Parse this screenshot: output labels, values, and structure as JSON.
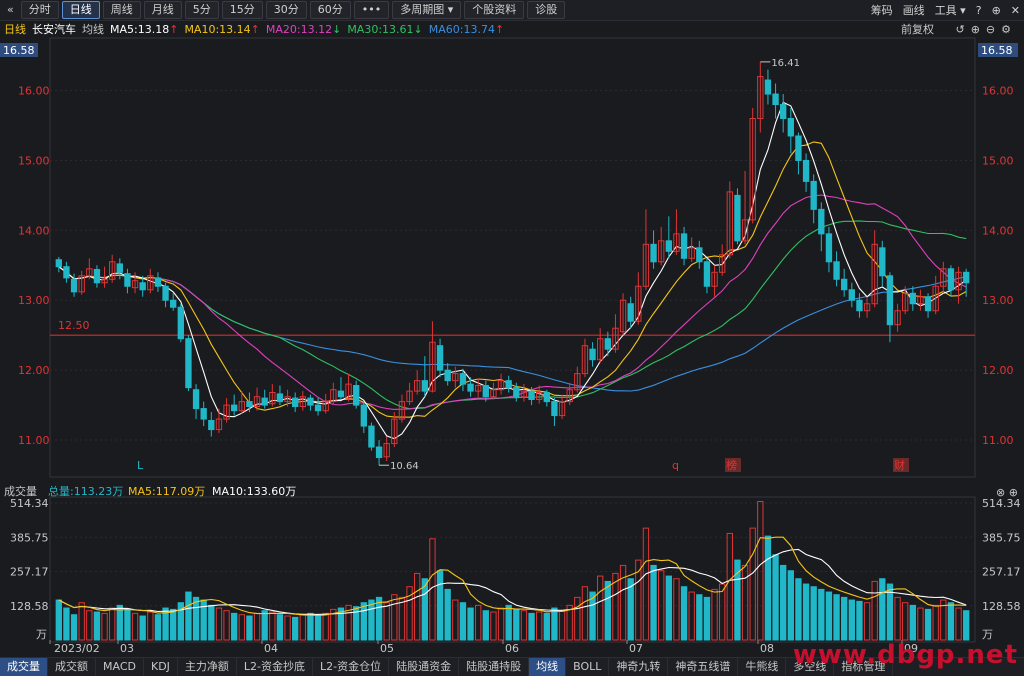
{
  "toolbar": {
    "back_icon": "chevron-double-left-icon",
    "periods": [
      "分时",
      "日线",
      "周线",
      "月线",
      "5分",
      "15分",
      "30分",
      "60分",
      "•••",
      "多周期图",
      "个股资料",
      "诊股"
    ],
    "active": "日线",
    "right": [
      "筹码",
      "画线",
      "工具"
    ],
    "icons": [
      "question-icon",
      "plus-circle-icon",
      "close-icon"
    ]
  },
  "info": {
    "period": "日线",
    "name": "长安汽车",
    "avg": "均线",
    "ma5": "MA5:13.18",
    "ma10": "MA10:13.14",
    "ma20": "MA20:13.12",
    "ma30": "MA30:13.61",
    "ma60": "MA60:13.74",
    "adjust": "前复权",
    "colors": {
      "ma5": "#ffffff",
      "ma10": "#f5c518",
      "ma20": "#e040c0",
      "ma30": "#30c060",
      "ma60": "#3a8fe0",
      "up": "#e03434",
      "down": "#20b8c8"
    }
  },
  "price_axis": {
    "top_label": "16.58",
    "ticks": [
      "16.00",
      "15.00",
      "14.00",
      "13.00",
      "12.00",
      "11.00"
    ],
    "high_label": "16.41",
    "low_label": "10.64",
    "line_label": "12.50",
    "markers": [
      "L",
      "q",
      "榜",
      "财"
    ]
  },
  "volume": {
    "title": "成交量",
    "total": "总量:113.23万",
    "ma5": "MA5:117.09万",
    "ma10": "MA10:133.60万",
    "ticks": [
      "514.34",
      "385.75",
      "257.17",
      "128.58",
      "万"
    ]
  },
  "x_axis": [
    "2023/02",
    "03",
    "04",
    "05",
    "06",
    "07",
    "08",
    "09"
  ],
  "bottom_tabs": [
    "成交量",
    "成交额",
    "MACD",
    "KDJ",
    "主力净额",
    "L2-资金抄底",
    "L2-资金仓位",
    "陆股通资金",
    "陆股通持股",
    "均线",
    "BOLL",
    "神奇九转",
    "神奇五线谱",
    "牛熊线",
    "多空线",
    "指标管理"
  ],
  "watermark": "www.dbgp.net",
  "chart_data": {
    "type": "candlestick",
    "price_range": [
      10.5,
      16.58
    ],
    "volume_range": [
      0,
      514.34
    ],
    "candles": [
      [
        13.58,
        13.48,
        13.62,
        13.4
      ],
      [
        13.48,
        13.32,
        13.55,
        13.25
      ],
      [
        13.3,
        13.12,
        13.38,
        13.05
      ],
      [
        13.12,
        13.35,
        13.42,
        13.08
      ],
      [
        13.35,
        13.45,
        13.6,
        13.3
      ],
      [
        13.44,
        13.25,
        13.5,
        13.18
      ],
      [
        13.25,
        13.3,
        13.48,
        13.18
      ],
      [
        13.3,
        13.55,
        13.65,
        13.25
      ],
      [
        13.52,
        13.4,
        13.6,
        13.3
      ],
      [
        13.38,
        13.2,
        13.45,
        13.1
      ],
      [
        13.18,
        13.28,
        13.4,
        13.1
      ],
      [
        13.25,
        13.15,
        13.35,
        13.05
      ],
      [
        13.15,
        13.35,
        13.45,
        13.1
      ],
      [
        13.32,
        13.2,
        13.4,
        13.12
      ],
      [
        13.2,
        13.0,
        13.25,
        12.9
      ],
      [
        13.0,
        12.9,
        13.1,
        12.85
      ],
      [
        12.9,
        12.45,
        12.95,
        12.4
      ],
      [
        12.45,
        11.75,
        12.5,
        11.7
      ],
      [
        11.72,
        11.45,
        11.8,
        11.3
      ],
      [
        11.45,
        11.3,
        11.55,
        11.2
      ],
      [
        11.28,
        11.15,
        11.4,
        11.05
      ],
      [
        11.15,
        11.3,
        11.45,
        11.1
      ],
      [
        11.3,
        11.5,
        11.6,
        11.25
      ],
      [
        11.5,
        11.42,
        11.65,
        11.35
      ],
      [
        11.42,
        11.55,
        11.7,
        11.38
      ],
      [
        11.55,
        11.48,
        11.68,
        11.4
      ],
      [
        11.48,
        11.62,
        11.75,
        11.42
      ],
      [
        11.6,
        11.5,
        11.72,
        11.45
      ],
      [
        11.52,
        11.68,
        11.8,
        11.48
      ],
      [
        11.66,
        11.55,
        11.78,
        11.5
      ],
      [
        11.55,
        11.62,
        11.72,
        11.48
      ],
      [
        11.6,
        11.48,
        11.68,
        11.4
      ],
      [
        11.48,
        11.62,
        11.7,
        11.42
      ],
      [
        11.6,
        11.5,
        11.65,
        11.42
      ],
      [
        11.5,
        11.42,
        11.6,
        11.35
      ],
      [
        11.42,
        11.56,
        11.66,
        11.38
      ],
      [
        11.55,
        11.72,
        11.82,
        11.5
      ],
      [
        11.7,
        11.62,
        11.9,
        11.58
      ],
      [
        11.6,
        11.8,
        11.95,
        11.55
      ],
      [
        11.78,
        11.5,
        11.85,
        11.45
      ],
      [
        11.5,
        11.2,
        11.55,
        11.1
      ],
      [
        11.2,
        10.9,
        11.25,
        10.85
      ],
      [
        10.9,
        10.75,
        11.0,
        10.64
      ],
      [
        10.76,
        10.95,
        11.05,
        10.7
      ],
      [
        10.95,
        11.3,
        11.4,
        10.9
      ],
      [
        11.3,
        11.55,
        11.65,
        11.25
      ],
      [
        11.55,
        11.7,
        11.82,
        11.5
      ],
      [
        11.7,
        11.85,
        12.0,
        11.65
      ],
      [
        11.85,
        11.7,
        12.2,
        11.62
      ],
      [
        11.7,
        12.4,
        12.7,
        11.68
      ],
      [
        12.35,
        12.0,
        12.45,
        11.9
      ],
      [
        12.0,
        11.85,
        12.1,
        11.78
      ],
      [
        11.85,
        11.95,
        12.05,
        11.75
      ],
      [
        11.95,
        11.8,
        12.02,
        11.7
      ],
      [
        11.8,
        11.7,
        11.9,
        11.62
      ],
      [
        11.7,
        11.78,
        11.88,
        11.62
      ],
      [
        11.78,
        11.62,
        11.85,
        11.55
      ],
      [
        11.62,
        11.72,
        11.82,
        11.58
      ],
      [
        11.72,
        11.85,
        11.95,
        11.65
      ],
      [
        11.85,
        11.75,
        11.92,
        11.68
      ],
      [
        11.75,
        11.62,
        11.82,
        11.55
      ],
      [
        11.62,
        11.7,
        11.8,
        11.55
      ],
      [
        11.7,
        11.58,
        11.76,
        11.5
      ],
      [
        11.58,
        11.68,
        11.78,
        11.52
      ],
      [
        11.68,
        11.55,
        11.72,
        11.48
      ],
      [
        11.55,
        11.35,
        11.6,
        11.2
      ],
      [
        11.35,
        11.55,
        11.65,
        11.3
      ],
      [
        11.55,
        11.72,
        11.82,
        11.5
      ],
      [
        11.72,
        11.95,
        12.05,
        11.68
      ],
      [
        11.95,
        12.35,
        12.45,
        11.9
      ],
      [
        12.3,
        12.15,
        12.4,
        12.05
      ],
      [
        12.15,
        12.45,
        12.6,
        12.1
      ],
      [
        12.45,
        12.3,
        12.55,
        12.2
      ],
      [
        12.3,
        12.6,
        12.8,
        12.25
      ],
      [
        12.55,
        13.0,
        13.1,
        12.5
      ],
      [
        12.95,
        12.7,
        13.05,
        12.6
      ],
      [
        12.7,
        13.2,
        13.4,
        12.65
      ],
      [
        13.2,
        13.8,
        14.3,
        13.15
      ],
      [
        13.8,
        13.55,
        14.0,
        13.45
      ],
      [
        13.55,
        13.85,
        14.05,
        13.5
      ],
      [
        13.85,
        13.7,
        14.2,
        13.6
      ],
      [
        13.7,
        13.95,
        14.3,
        13.65
      ],
      [
        13.95,
        13.6,
        14.05,
        13.5
      ],
      [
        13.6,
        13.75,
        13.9,
        13.55
      ],
      [
        13.75,
        13.55,
        13.85,
        13.45
      ],
      [
        13.55,
        13.2,
        13.6,
        13.1
      ],
      [
        13.2,
        13.4,
        13.5,
        13.05
      ],
      [
        13.4,
        13.65,
        13.8,
        13.35
      ],
      [
        13.65,
        14.55,
        14.7,
        13.6
      ],
      [
        14.5,
        13.85,
        14.6,
        13.8
      ],
      [
        13.85,
        14.15,
        14.85,
        13.8
      ],
      [
        14.15,
        15.6,
        15.75,
        14.1
      ],
      [
        15.6,
        16.2,
        16.41,
        15.4
      ],
      [
        16.15,
        15.95,
        16.3,
        15.8
      ],
      [
        15.95,
        15.8,
        16.1,
        15.6
      ],
      [
        15.8,
        15.6,
        15.95,
        15.4
      ],
      [
        15.6,
        15.35,
        15.75,
        15.1
      ],
      [
        15.35,
        15.0,
        15.4,
        14.8
      ],
      [
        15.0,
        14.7,
        15.1,
        14.55
      ],
      [
        14.7,
        14.3,
        14.8,
        14.1
      ],
      [
        14.3,
        13.95,
        14.4,
        13.7
      ],
      [
        13.95,
        13.55,
        14.05,
        13.4
      ],
      [
        13.55,
        13.3,
        13.7,
        13.2
      ],
      [
        13.3,
        13.15,
        13.45,
        13.05
      ],
      [
        13.15,
        13.0,
        13.25,
        12.9
      ],
      [
        13.0,
        12.85,
        13.1,
        12.75
      ],
      [
        12.85,
        12.95,
        13.05,
        12.75
      ],
      [
        12.95,
        13.8,
        14.0,
        12.9
      ],
      [
        13.75,
        13.35,
        13.85,
        13.2
      ],
      [
        13.35,
        12.65,
        13.4,
        12.4
      ],
      [
        12.65,
        12.85,
        12.95,
        12.55
      ],
      [
        12.85,
        13.1,
        13.2,
        12.8
      ],
      [
        13.1,
        12.95,
        13.2,
        12.85
      ],
      [
        12.95,
        13.05,
        13.15,
        12.85
      ],
      [
        13.05,
        12.85,
        13.1,
        12.75
      ],
      [
        12.85,
        13.2,
        13.35,
        12.8
      ],
      [
        13.2,
        13.45,
        13.55,
        13.1
      ],
      [
        13.45,
        13.15,
        13.5,
        13.05
      ],
      [
        13.15,
        13.4,
        13.48,
        12.95
      ],
      [
        13.4,
        13.25,
        13.45,
        13.05
      ]
    ],
    "volumes": [
      150,
      120,
      95,
      140,
      110,
      105,
      100,
      120,
      130,
      115,
      100,
      90,
      105,
      95,
      120,
      115,
      140,
      180,
      160,
      150,
      130,
      120,
      110,
      100,
      95,
      90,
      100,
      110,
      105,
      95,
      90,
      85,
      95,
      100,
      90,
      100,
      115,
      120,
      130,
      125,
      140,
      150,
      160,
      140,
      170,
      160,
      200,
      250,
      230,
      380,
      260,
      190,
      150,
      140,
      120,
      130,
      110,
      105,
      120,
      130,
      115,
      110,
      100,
      105,
      100,
      120,
      110,
      130,
      160,
      200,
      180,
      240,
      220,
      250,
      280,
      230,
      300,
      420,
      280,
      260,
      240,
      230,
      200,
      180,
      170,
      160,
      190,
      210,
      400,
      300,
      280,
      420,
      520,
      390,
      320,
      280,
      260,
      230,
      210,
      200,
      190,
      180,
      170,
      160,
      150,
      145,
      140,
      220,
      230,
      210,
      160,
      140,
      130,
      120,
      115,
      130,
      150,
      140,
      120,
      110
    ],
    "series": [
      {
        "name": "MA5"
      },
      {
        "name": "MA10"
      },
      {
        "name": "MA20"
      },
      {
        "name": "MA30"
      },
      {
        "name": "MA60"
      }
    ]
  }
}
